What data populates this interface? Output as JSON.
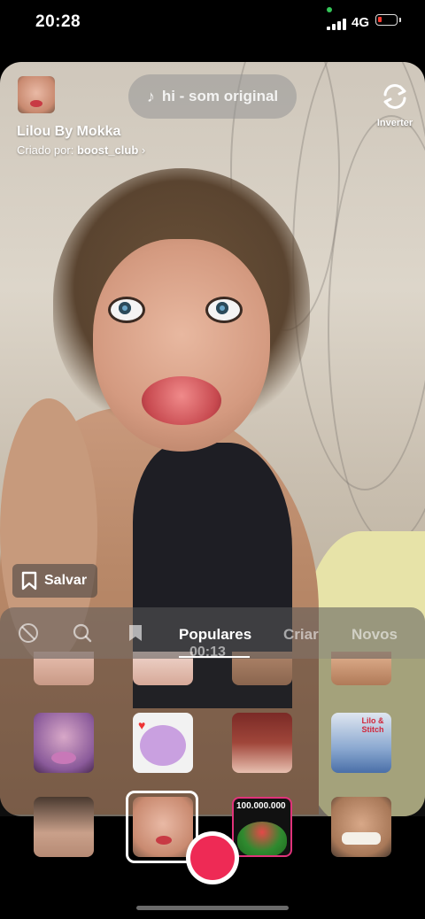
{
  "status_bar": {
    "time": "20:28",
    "network": "4G"
  },
  "effect": {
    "name": "Lilou By Mokka",
    "creator_prefix": "Criado por:",
    "creator": "boost_club",
    "chevron": "›"
  },
  "sound": {
    "label": "hi - som original",
    "icon": "music-note-icon"
  },
  "flip": {
    "label": "Inverter"
  },
  "save": {
    "label": "Salvar"
  },
  "tabs": {
    "items": [
      "Populares",
      "Criar",
      "Novos"
    ],
    "active": "Populares"
  },
  "timer": "00:13",
  "effect_tiles": {
    "badge_text": "100.000.000",
    "stitch_logo": "Lilo & Stitch"
  },
  "colors": {
    "record": "#ee2a55",
    "battery_low": "#ff3b30",
    "status_dot": "#35c759"
  }
}
